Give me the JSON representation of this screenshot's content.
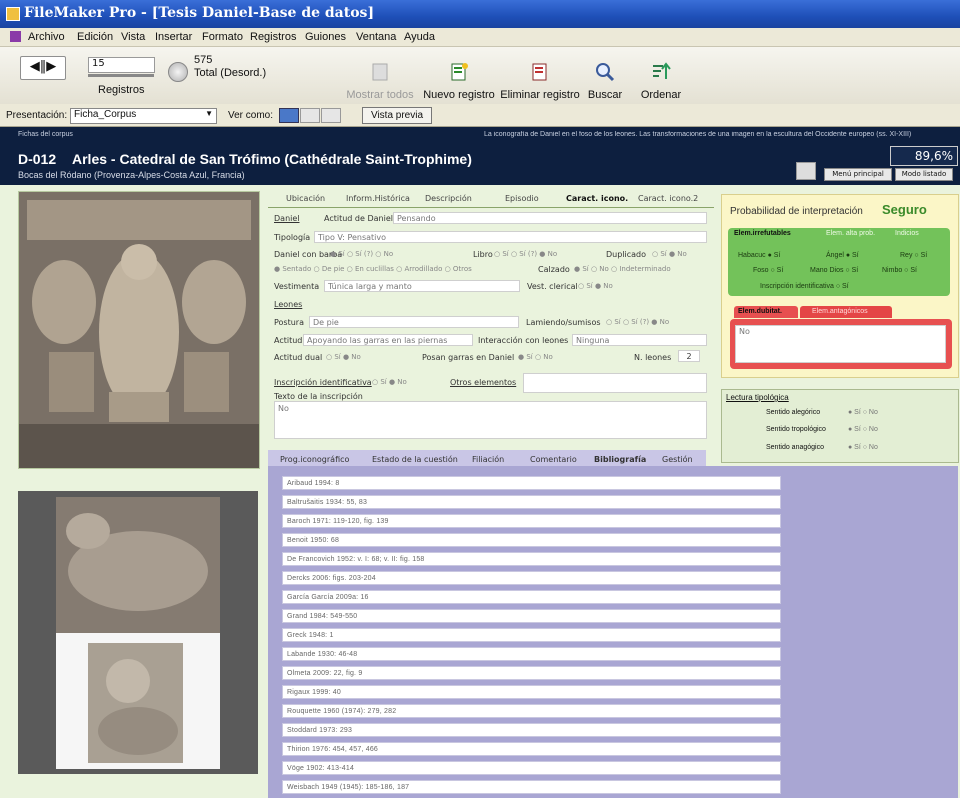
{
  "window": {
    "title": "FileMaker Pro - [Tesis Daniel-Base de datos]"
  },
  "menu": [
    "Archivo",
    "Edición",
    "Vista",
    "Insertar",
    "Formato",
    "Registros",
    "Guiones",
    "Ventana",
    "Ayuda"
  ],
  "toolbar": {
    "record_number": "15",
    "records_label": "Registros",
    "total_count": "575",
    "total_label": "Total (Desord.)",
    "buttons": [
      "Mostrar todos",
      "Nuevo registro",
      "Eliminar registro",
      "Buscar",
      "Ordenar"
    ]
  },
  "layoutbar": {
    "presentation_label": "Presentación:",
    "presentation_value": "Ficha_Corpus",
    "view_as_label": "Ver como:",
    "preview_button": "Vista previa"
  },
  "header": {
    "corpus_label": "Fichas del corpus",
    "subtitle_right": "La iconografía de Daniel en el foso de los leones. Las transformaciones de una imagen en la escultura del Occidente europeo (ss. XI-XIII)",
    "code": "D-012",
    "title": "Arles - Catedral de San Trófimo (Cathédrale Saint-Trophime)",
    "location": "Bocas del Ródano (Provenza-Alpes-Costa Azul, Francia)",
    "percent": "89,6%",
    "btn_menu": "Menú principal",
    "btn_list": "Modo listado"
  },
  "form": {
    "tabs": [
      "Ubicación",
      "Inform.Histórica",
      "Descripción",
      "Episodio",
      "Caract. icono.",
      "Caract. icono.2"
    ],
    "daniel_label": "Daniel",
    "actitud_label": "Actitud de Daniel",
    "actitud_value": "Pensando",
    "tipologia_label": "Tipología",
    "tipologia_value": "Tipo V: Pensativo",
    "barba_line": "Daniel con barba",
    "barba_opts": "● Sí   ○ Sí (?)   ○ No",
    "libro_label": "Libro",
    "libro_opts": "○ Sí   ○ Sí (?)   ● No",
    "duplicado_label": "Duplicado",
    "duplicado_opts": "○ Sí   ● No",
    "pose_opts": "● Sentado   ○ De pie   ○ En cuclillas   ○ Arrodillado   ○ Otros",
    "calzado_label": "Calzado",
    "calzado_opts": "● Sí   ○ No   ○ Indeterminado",
    "vestimenta_label": "Vestimenta",
    "vestimenta_value": "Túnica larga y manto",
    "vest_clerical_label": "Vest. clerical",
    "vest_clerical_opts": "○ Sí   ● No",
    "leones_label": "Leones",
    "postura_label": "Postura",
    "postura_value": "De pie",
    "lamiendo_label": "Lamiendo/sumisos",
    "lamiendo_opts": "○ Sí   ○ Sí (?)   ● No",
    "actitud2_label": "Actitud",
    "actitud2_value": "Apoyando las garras en las piernas",
    "interaccion_label": "Interacción con leones",
    "interaccion_value": "Ninguna",
    "dual_label": "Actitud dual",
    "dual_opts": "○ Sí   ● No",
    "posan_label": "Posan garras en Daniel",
    "posan_opts": "● Sí   ○ No",
    "nleones_label": "N. leones",
    "nleones_value": "2",
    "inscripcion_label": "Inscripción identificativa",
    "inscripcion_opts": "○ Sí   ● No",
    "otros_label": "Otros elementos",
    "texto_label": "Texto de la inscripción",
    "texto_value": "No"
  },
  "prob": {
    "label": "Probabilidad de interpretación",
    "value": "Seguro",
    "tabs": [
      "Elem.irrefutables",
      "Elem. alta prob.",
      "Indicios"
    ],
    "habacuc": "Habacuc  ● Sí",
    "angel": "Ángel  ● Sí",
    "rey": "Rey  ○ Sí",
    "foso": "Foso  ○ Sí",
    "mano": "Mano Dios  ○ Sí",
    "nimbo": "Nimbo  ○ Sí",
    "inscr": "Inscripción identificativa  ○ Sí",
    "red_tabs": [
      "Elem.dubitat.",
      "Elem.antagónicos"
    ],
    "red_value": "No"
  },
  "lectura": {
    "label": "Lectura tipológica",
    "rows": [
      {
        "name": "Sentido alegórico",
        "opts": "● Sí   ○ No"
      },
      {
        "name": "Sentido tropológico",
        "opts": "● Sí   ○ No"
      },
      {
        "name": "Sentido anagógico",
        "opts": "● Sí   ○ No"
      }
    ]
  },
  "bib": {
    "tabs": [
      "Prog.iconográfico",
      "Estado de la cuestión",
      "Filiación",
      "Comentario",
      "Bibliografía",
      "Gestión"
    ],
    "rows": [
      "Aribaud 1994: 8",
      "Baltrušaitis 1934: 55, 83",
      "Baroch 1971: 119-120, fig. 139",
      "Benoit 1950: 68",
      "De Francovich 1952: v. I: 68; v. II: fig. 158",
      "Dercks 2006: figs. 203-204",
      "García García 2009a: 16",
      "Grand 1984: 549-550",
      "Greck 1948: 1",
      "Labande 1930: 46-48",
      "Olmeta 2009: 22, fig. 9",
      "Rigaux 1999: 40",
      "Rouquette 1960 (1974): 279, 282",
      "Stoddard 1973: 293",
      "Thirion 1976: 454, 457, 466",
      "Vöge 1902: 413-414",
      "Weisbach 1949 (1945): 185-186, 187"
    ]
  }
}
